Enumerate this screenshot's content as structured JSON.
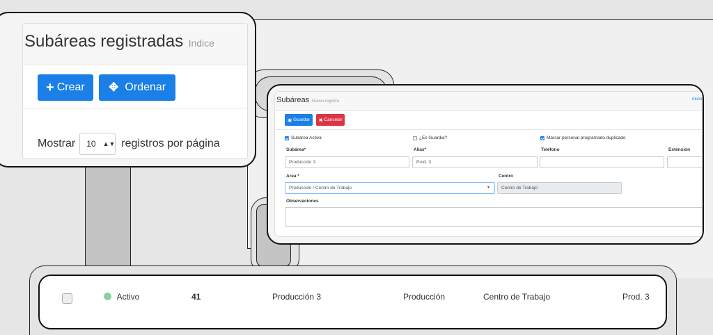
{
  "list_card": {
    "title": "Subáreas registradas",
    "subtitle": "Indice",
    "buttons": {
      "create": "Crear",
      "order": "Ordenar"
    },
    "show": {
      "prefix": "Mostrar",
      "value": "10",
      "suffix": "registros por página"
    }
  },
  "form_card": {
    "title": "Subáreas",
    "subtitle": "Nuevo registro",
    "index_link": "Inicio",
    "buttons": {
      "save": "Guardar",
      "cancel": "Cancelar"
    },
    "checkboxes": {
      "active": {
        "label": "Subárea Activa",
        "checked": true
      },
      "guard": {
        "label": "¿Es Guardia?",
        "checked": false
      },
      "duplicate": {
        "label": "Marcar personal programado duplicado",
        "checked": true
      }
    },
    "fields": {
      "subarea": {
        "label": "Subárea*",
        "value": "Producción 3"
      },
      "alias": {
        "label": "Alias*",
        "value": "Prod. 3"
      },
      "telefono": {
        "label": "Teléfono",
        "value": ""
      },
      "extension": {
        "label": "Extensión",
        "value": ""
      },
      "area": {
        "label": "Area *",
        "value": "Producción / Centro de Trabajo"
      },
      "centro": {
        "label": "Centro",
        "value": "Centro de Trabajo"
      },
      "observaciones": {
        "label": "Observaciones",
        "value": ""
      }
    }
  },
  "table_row": {
    "status": "Activo",
    "id": "41",
    "subarea": "Producción 3",
    "area": "Producción",
    "centro": "Centro de Trabajo",
    "alias": "Prod. 3"
  },
  "colors": {
    "primary": "#1a7fe6",
    "danger": "#dc3545",
    "active_dot": "#8fd19e"
  }
}
